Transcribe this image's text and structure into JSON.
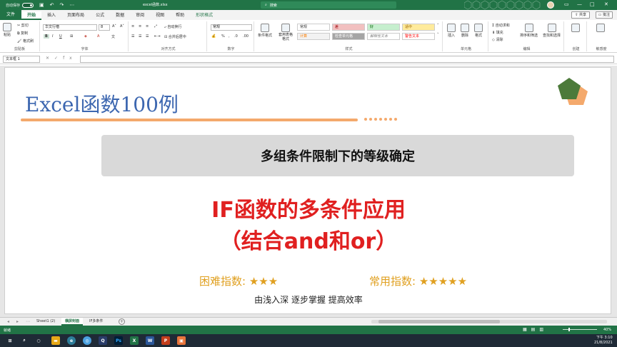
{
  "titlebar": {
    "autosave_label": "自动保存",
    "autosave_state": "关",
    "filename": "excel函数.xlsx",
    "search_placeholder": "搜索"
  },
  "menu": {
    "items": [
      "文件",
      "开始",
      "插入",
      "页面布局",
      "公式",
      "数据",
      "审阅",
      "视图",
      "帮助",
      "形状格式"
    ],
    "active": "开始",
    "share_label": "共享",
    "comment_label": "批注"
  },
  "ribbon": {
    "clipboard": {
      "paste": "粘贴",
      "cut": "剪切",
      "copy": "复制",
      "format_painter": "格式刷",
      "label": "剪贴板"
    },
    "font": {
      "name": "华文行楷",
      "size": "8",
      "label": "字体"
    },
    "alignment": {
      "wrap": "自动换行",
      "merge": "合并后居中",
      "label": "对齐方式"
    },
    "number": {
      "format": "常规",
      "label": "数字"
    },
    "styles": {
      "cond_format": "条件格式",
      "table_format": "套用表格格式",
      "cells": [
        {
          "text": "常规",
          "bg": "#ffffff",
          "color": "#333333"
        },
        {
          "text": "差",
          "bg": "#f2c0c0",
          "color": "#9c0006"
        },
        {
          "text": "好",
          "bg": "#c6efce",
          "color": "#006100"
        },
        {
          "text": "适中",
          "bg": "#ffeb9c",
          "color": "#9c6500"
        },
        {
          "text": "计算",
          "bg": "#f2f2f2",
          "color": "#fa7d00"
        },
        {
          "text": "检查单元格",
          "bg": "#a5a5a5",
          "color": "#ffffff"
        },
        {
          "text": "解释性文本",
          "bg": "#ffffff",
          "color": "#7f7f7f"
        },
        {
          "text": "警告文本",
          "bg": "#ffffff",
          "color": "#ff0000"
        }
      ],
      "label": "样式"
    },
    "cells": {
      "insert": "插入",
      "delete": "删除",
      "format": "格式",
      "label": "单元格"
    },
    "editing": {
      "autosum": "自动求和",
      "fill": "填充",
      "clear": "清除",
      "sort": "排序和筛选",
      "find": "查找和选择",
      "label": "编辑"
    },
    "create": {
      "label": "创建"
    },
    "sensitivity": {
      "label": "敏感度"
    }
  },
  "formula": {
    "namebox": "文本框 1",
    "fx": "fx"
  },
  "slide": {
    "main_title": "Excel函数100例",
    "subtitle": "多组条件限制下的等级确定",
    "red_line1": "IF函数的多条件应用",
    "red_line2": "（结合and和or）",
    "difficulty_label": "困难指数:",
    "difficulty_stars": "★★★",
    "usage_label": "常用指数:",
    "usage_stars": "★★★★★",
    "tagline": "由浅入深  逐步掌握  提高效率",
    "title_color": "#3d67b0",
    "accent_color": "#f4a96c",
    "red_color": "#e02020",
    "star_color": "#e0a020"
  },
  "sheet_tabs": {
    "tabs": [
      "Sheet1 (2)",
      "横屏封面",
      "IF多条件"
    ],
    "active": "横屏封面"
  },
  "status": {
    "ready": "就绪",
    "zoom": "40%"
  },
  "taskbar": {
    "time": "下午 3:10",
    "date": "21/8/2021"
  }
}
